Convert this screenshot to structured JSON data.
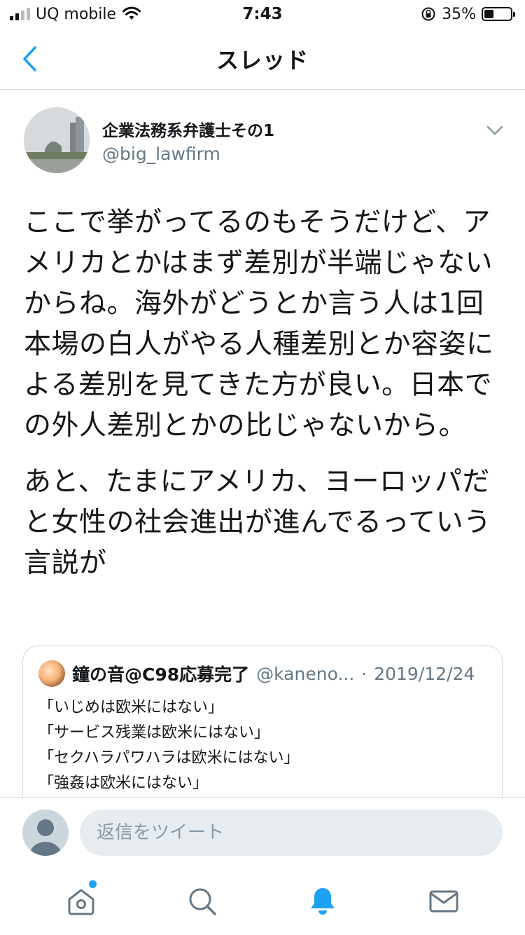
{
  "status_bar": {
    "carrier": "UQ mobile",
    "time": "7:43",
    "battery_percent": "35%",
    "battery_level": 0.35
  },
  "nav": {
    "title": "スレッド"
  },
  "tweet": {
    "author_name": "企業法務系弁護士その1",
    "author_handle": "@big_lawfirm",
    "paragraphs": [
      "ここで挙がってるのもそうだけど、アメリカとかはまず差別が半端じゃないからね。海外がどうとか言う人は1回本場の白人がやる人種差別とか容姿による差別を見てきた方が良い。日本での外人差別とかの比じゃないから。",
      "あと、たまにアメリカ、ヨーロッパだと女性の社会進出が進んでるっていう言説が"
    ]
  },
  "quote": {
    "name": "鐘の音@C98応募完了",
    "handle": "@kaneno...",
    "separator": "·",
    "date": "2019/12/24",
    "lines": [
      "「いじめは欧米にはない」",
      "「サービス残業は欧米にはない」",
      "「セクハラパワハラは欧米にはない」",
      "「強姦は欧米にはない」"
    ]
  },
  "reply": {
    "placeholder": "返信をツイート"
  },
  "tabs": {
    "icons": [
      "home-icon",
      "search-icon",
      "notifications-icon",
      "messages-icon"
    ],
    "active": "notifications-icon"
  },
  "colors": {
    "accent": "#1da1f2",
    "secondary_text": "#657786",
    "border": "#ccd6dd"
  }
}
